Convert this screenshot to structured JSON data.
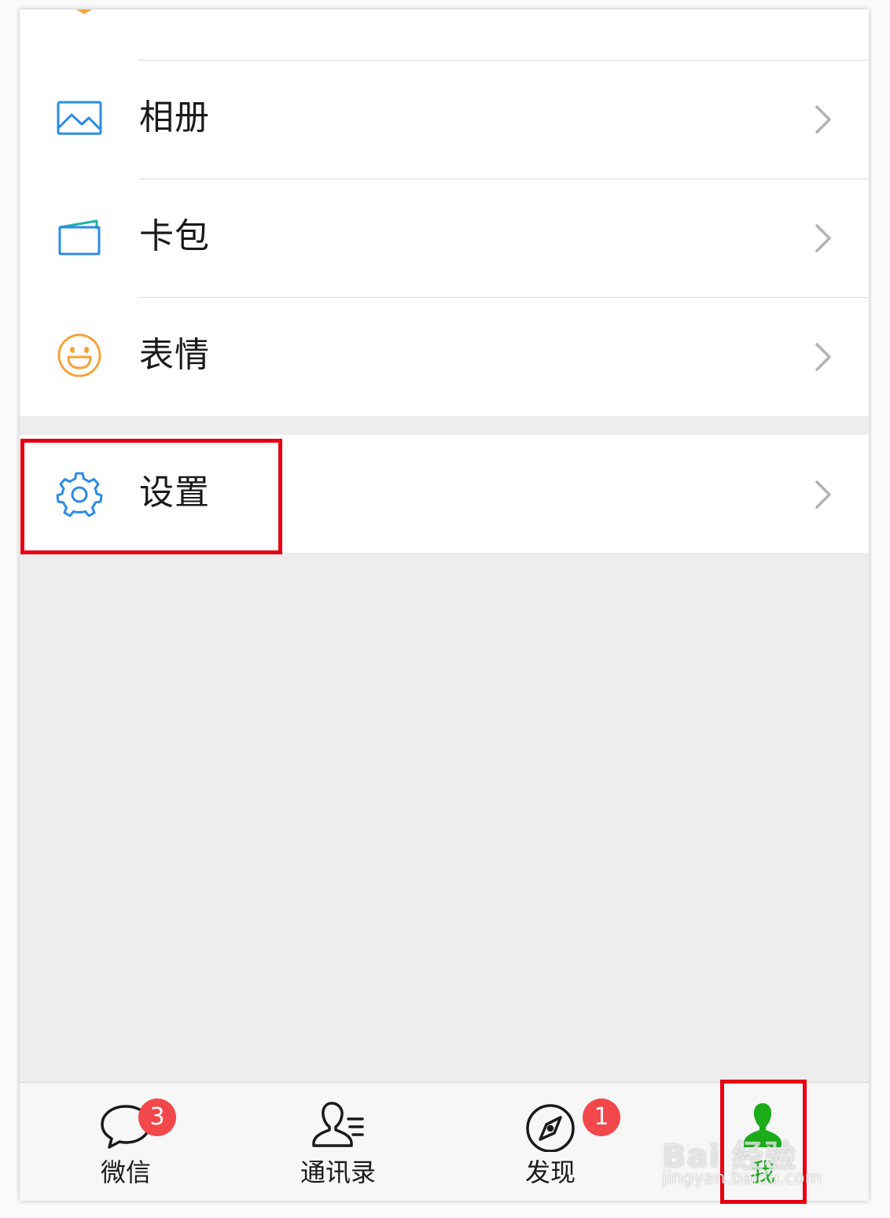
{
  "menu": {
    "items": [
      {
        "label": "相册",
        "icon": "photo-album-icon",
        "color": "#2b8be6"
      },
      {
        "label": "卡包",
        "icon": "card-wallet-icon",
        "color": "#2b8be6"
      },
      {
        "label": "表情",
        "icon": "smiley-face-icon",
        "color": "#f3a33b"
      }
    ],
    "settings": {
      "label": "设置",
      "icon": "gear-icon",
      "color": "#2b8be6"
    }
  },
  "tabbar": {
    "tabs": [
      {
        "label": "微信",
        "icon": "chat-bubble-icon",
        "badge": "3"
      },
      {
        "label": "通讯录",
        "icon": "contacts-icon",
        "badge": ""
      },
      {
        "label": "发现",
        "icon": "compass-icon",
        "badge": "1"
      },
      {
        "label": "我",
        "icon": "person-icon",
        "badge": "",
        "active": true
      }
    ],
    "active_color": "#1aad19",
    "badge_color": "#f2484b"
  },
  "annotation_color": "#e60012",
  "watermark": {
    "brand": "Bai 经验",
    "url": "jingyan.baidu.com"
  }
}
